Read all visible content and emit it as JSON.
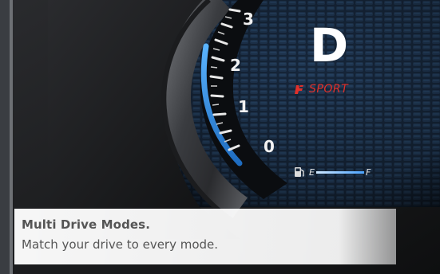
{
  "cluster": {
    "gear": "D",
    "drive_mode": "SPORT",
    "fuel_empty_label": "E",
    "fuel_full_label": "F",
    "gauge_numbers": [
      "3",
      "2",
      "1",
      "0"
    ]
  },
  "caption": {
    "title": "Multi Drive Modes.",
    "subtitle": "Match your drive to every mode."
  },
  "colors": {
    "accent_blue": "#2f8fe0",
    "sport_red": "#e0302a",
    "gear_text": "#ffffff"
  },
  "icons": [
    "sport-mode-icon",
    "fuel-pump-icon"
  ]
}
